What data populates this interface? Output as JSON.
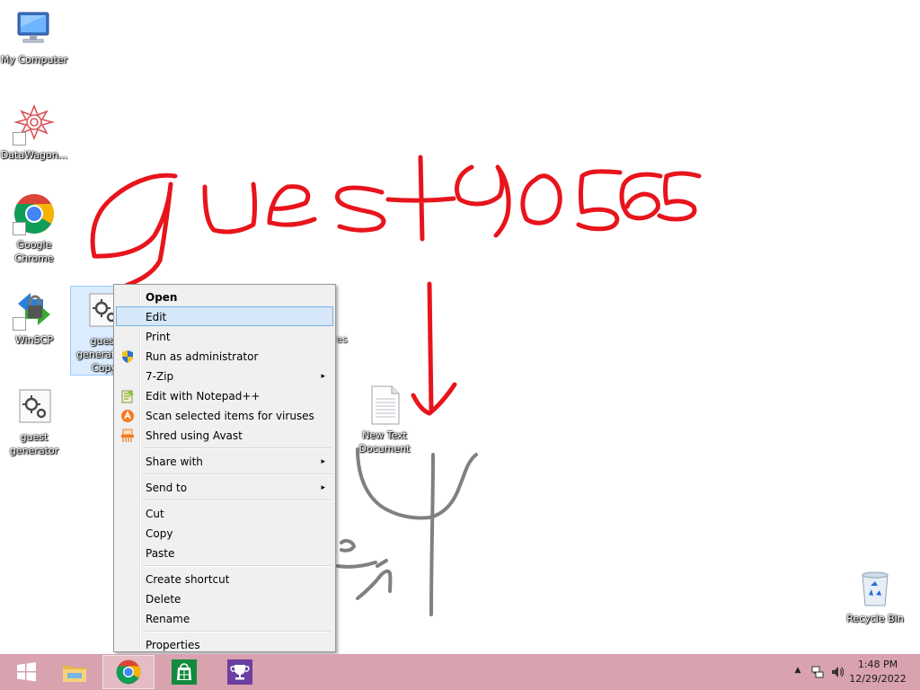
{
  "desktop": {
    "icons": [
      {
        "label": "My Computer",
        "icon": "computer-icon"
      },
      {
        "label": "DataWagon...",
        "icon": "datawagon-icon"
      },
      {
        "label": "Google Chrome",
        "icon": "chrome-icon"
      },
      {
        "label": "WinSCP",
        "icon": "winscp-icon"
      },
      {
        "label": "guest generator - Copy",
        "icon": "script-file-icon"
      },
      {
        "label": "guest generator",
        "icon": "script-file-icon"
      },
      {
        "label": "New Text Document",
        "icon": "text-document-icon"
      },
      {
        "label": "Recycle Bin",
        "icon": "recycle-bin-icon"
      }
    ],
    "hidden_label_fragment": "es",
    "scribble": {
      "main_text": "guest90565",
      "second_text": "gen",
      "colors": {
        "red": "#e8141c",
        "gray": "#808080"
      }
    }
  },
  "context_menu": {
    "items": [
      {
        "label": "Open",
        "bold": true
      },
      {
        "label": "Edit",
        "highlighted": true
      },
      {
        "label": "Print"
      },
      {
        "label": "Run as administrator",
        "icon": "uac-shield-icon"
      },
      {
        "label": "7-Zip",
        "submenu": true
      },
      {
        "label": "Edit with Notepad++",
        "icon": "notepad-plus-plus-icon"
      },
      {
        "label": "Scan selected items for viruses",
        "icon": "avast-icon"
      },
      {
        "label": "Shred using Avast",
        "icon": "avast-shredder-icon"
      },
      {
        "label": "Share with",
        "submenu": true
      },
      {
        "label": "Send to",
        "submenu": true
      },
      {
        "label": "Cut"
      },
      {
        "label": "Copy"
      },
      {
        "label": "Paste"
      },
      {
        "label": "Create shortcut"
      },
      {
        "label": "Delete"
      },
      {
        "label": "Rename"
      },
      {
        "label": "Properties"
      }
    ],
    "submenu_arrow": "▸"
  },
  "taskbar": {
    "color": "#d8a2ae",
    "buttons": [
      {
        "name": "start",
        "icon": "windows-logo-icon"
      },
      {
        "name": "file-explorer",
        "icon": "folder-icon"
      },
      {
        "name": "chrome",
        "icon": "chrome-icon",
        "active": true
      },
      {
        "name": "store",
        "icon": "store-icon"
      },
      {
        "name": "trophy-app",
        "icon": "trophy-icon"
      }
    ],
    "tray": {
      "chevron": "▲",
      "time": "1:48 PM",
      "date": "12/29/2022"
    }
  }
}
